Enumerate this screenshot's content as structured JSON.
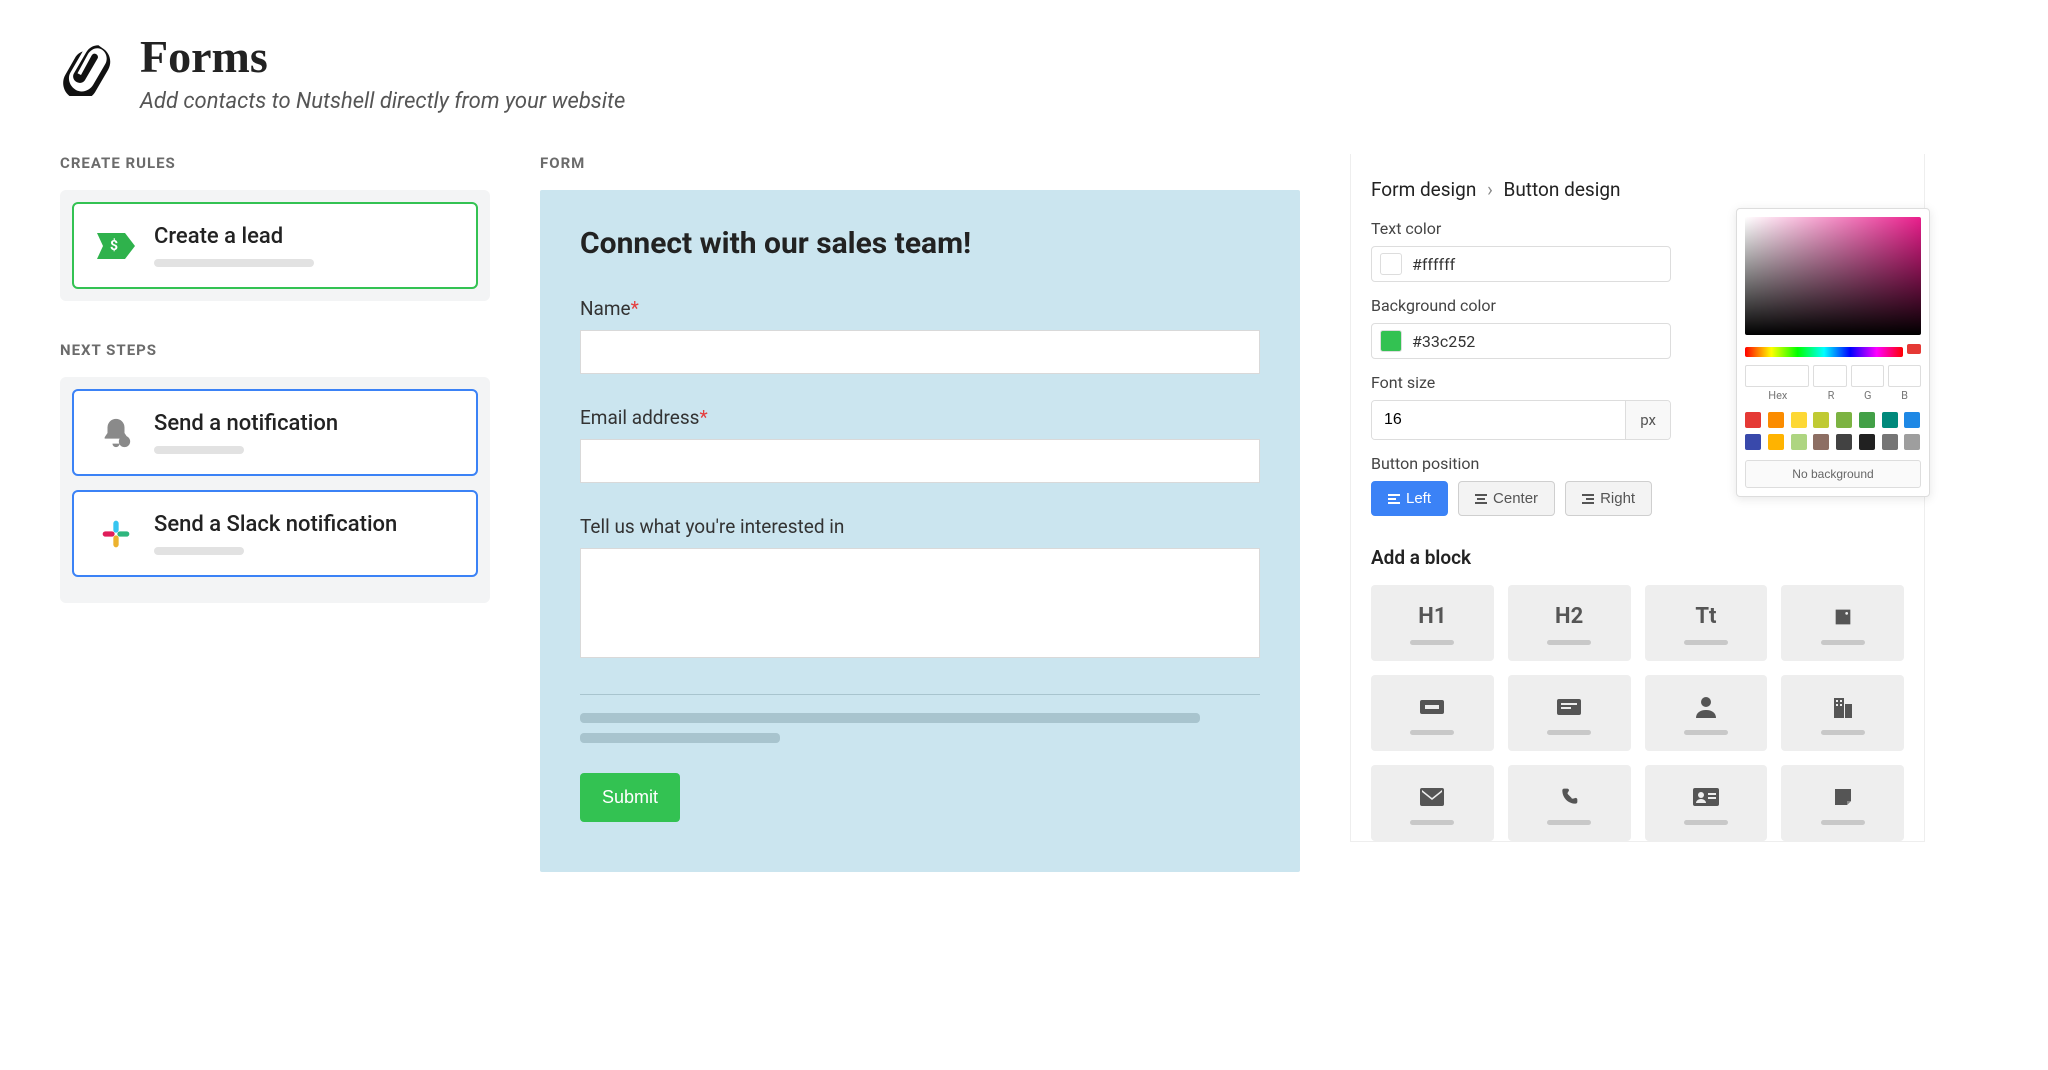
{
  "header": {
    "title": "Forms",
    "subtitle": "Add contacts to Nutshell directly from your website"
  },
  "left": {
    "create_rules_label": "CREATE RULES",
    "rules": [
      {
        "title": "Create a lead"
      }
    ],
    "next_steps_label": "NEXT STEPS",
    "steps": [
      {
        "title": "Send a notification"
      },
      {
        "title": "Send a Slack notification"
      }
    ]
  },
  "form": {
    "section_label": "FORM",
    "title": "Connect with our sales team!",
    "fields": {
      "name_label": "Name",
      "email_label": "Email address",
      "interest_label": "Tell us what you're interested in"
    },
    "submit_label": "Submit"
  },
  "design": {
    "breadcrumb": {
      "root": "Form design",
      "current": "Button design"
    },
    "text_color": {
      "label": "Text color",
      "value": "#ffffff",
      "swatch": "#ffffff"
    },
    "bg_color": {
      "label": "Background color",
      "value": "#33c252",
      "swatch": "#33c252"
    },
    "font_size": {
      "label": "Font size",
      "value": "16",
      "unit": "px"
    },
    "position": {
      "label": "Button position",
      "left": "Left",
      "center": "Center",
      "right": "Right",
      "active": "left"
    },
    "picker": {
      "labels": {
        "hex": "Hex",
        "r": "R",
        "g": "G",
        "b": "B"
      },
      "swatches": [
        "#e53935",
        "#fb8c00",
        "#fdd835",
        "#c0ca33",
        "#7cb342",
        "#43a047",
        "#00897b",
        "#1e88e5",
        "#3949ab",
        "#ffb300",
        "#aed581",
        "#8d6e63",
        "#424242",
        "#212121",
        "#757575",
        "#9e9e9e"
      ],
      "no_bg_label": "No background"
    },
    "add_block": {
      "title": "Add a block",
      "items": [
        {
          "label": "H1",
          "name": "heading-1"
        },
        {
          "label": "H2",
          "name": "heading-2"
        },
        {
          "label": "Tt",
          "name": "text"
        },
        {
          "icon": "image",
          "name": "image"
        },
        {
          "icon": "button",
          "name": "button"
        },
        {
          "icon": "card",
          "name": "card"
        },
        {
          "icon": "person",
          "name": "person"
        },
        {
          "icon": "company",
          "name": "company"
        },
        {
          "icon": "envelope",
          "name": "email"
        },
        {
          "icon": "phone",
          "name": "phone"
        },
        {
          "icon": "id-card",
          "name": "contact-card"
        },
        {
          "icon": "note",
          "name": "note"
        }
      ]
    }
  }
}
